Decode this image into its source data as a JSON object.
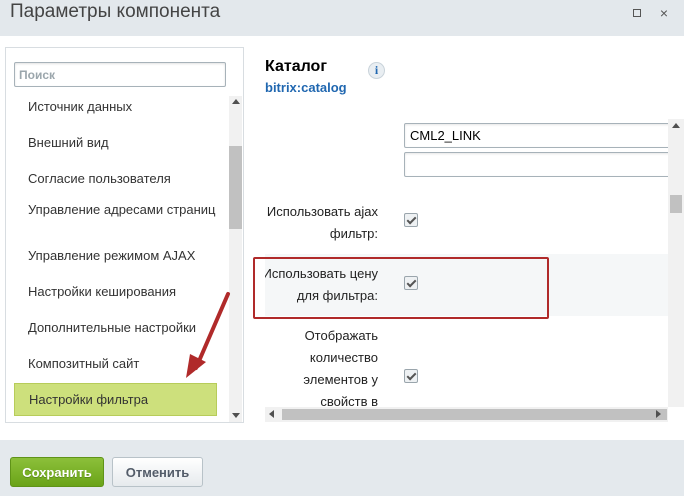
{
  "window": {
    "title": "Параметры компонента",
    "minimize_icon": "minimize-icon",
    "close_label": "×"
  },
  "sidebar": {
    "search_placeholder": "Поиск",
    "items": [
      {
        "label": "Источник данных"
      },
      {
        "label": "Внешний вид"
      },
      {
        "label": "Согласие пользователя"
      },
      {
        "label": "Управление адресами страниц"
      },
      {
        "label": "Управление режимом AJAX"
      },
      {
        "label": "Настройки кеширования"
      },
      {
        "label": "Дополнительные настройки"
      },
      {
        "label": "Композитный сайт"
      },
      {
        "label": "Настройки фильтра",
        "active": true
      }
    ]
  },
  "component": {
    "title": "Каталог",
    "id": "bitrix:catalog",
    "info_label": "i"
  },
  "props": {
    "input1_value": "CML2_LINK",
    "input2_value": "",
    "rows": [
      {
        "label": "Использовать ajax фильтр:",
        "checked": true
      },
      {
        "label": "Использовать цену для фильтра:",
        "checked": true
      },
      {
        "label": "Отображать количество элементов у свойств в",
        "checked": true
      }
    ]
  },
  "footer": {
    "save_label": "Сохранить",
    "cancel_label": "Отменить"
  },
  "colors": {
    "save_button": "#6aa318",
    "active_item": "#cde07c",
    "highlight_border": "#b02a2a",
    "arrow": "#b02a2a",
    "link": "#2067b0"
  }
}
